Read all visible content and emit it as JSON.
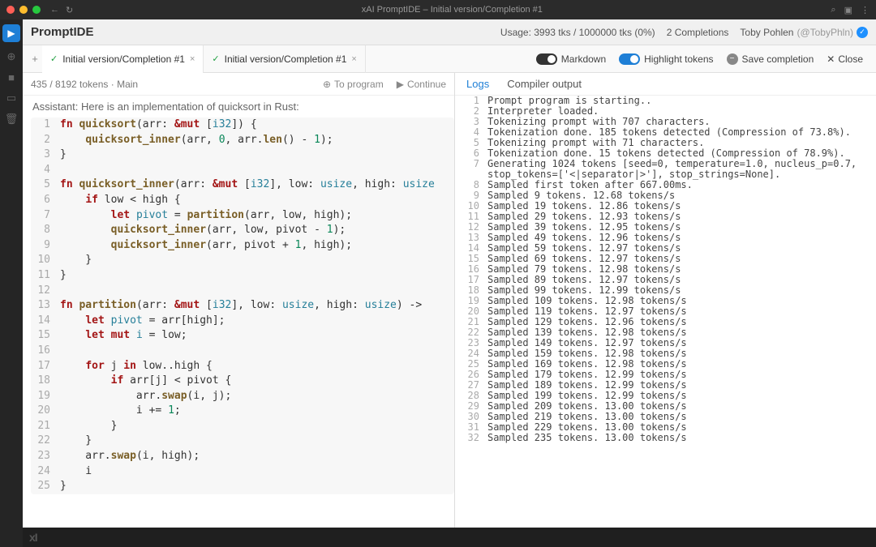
{
  "window": {
    "title": "xAI PromptIDE – Initial version/Completion #1"
  },
  "topbar": {
    "brand": "PromptIDE",
    "usage": "Usage: 3993 tks / 1000000 tks (0%)",
    "completions": "2 Completions",
    "user_name": "Toby Pohlen",
    "user_handle": "(@TobyPhln)"
  },
  "tabs": [
    {
      "label": "Initial version/Completion #1",
      "active": true
    },
    {
      "label": "Initial version/Completion #1",
      "active": false
    }
  ],
  "tabrow": {
    "markdown": "Markdown",
    "highlight": "Highlight tokens",
    "save": "Save completion",
    "close": "Close"
  },
  "infobar": {
    "tokens": "435 / 8192 tokens · Main",
    "toprogram": "To program",
    "continue": "Continue"
  },
  "assistant_line": "Assistant: Here is an implementation of quicksort in Rust:",
  "code": [
    {
      "n": 1,
      "t": [
        [
          "kw",
          "fn "
        ],
        [
          "fn",
          "quicksort"
        ],
        [
          "",
          "(arr: "
        ],
        [
          "kw",
          "&mut"
        ],
        [
          "",
          " ["
        ],
        [
          "ty",
          "i32"
        ],
        [
          "",
          "]) {"
        ]
      ]
    },
    {
      "n": 2,
      "t": [
        [
          "",
          "    "
        ],
        [
          "fn",
          "quicksort_inner"
        ],
        [
          "",
          "(arr, "
        ],
        [
          "nm",
          "0"
        ],
        [
          "",
          ", arr."
        ],
        [
          "fn",
          "len"
        ],
        [
          "",
          "() - "
        ],
        [
          "nm",
          "1"
        ],
        [
          "",
          ");"
        ]
      ]
    },
    {
      "n": 3,
      "t": [
        [
          "",
          "}"
        ]
      ]
    },
    {
      "n": 4,
      "t": [
        [
          "",
          ""
        ]
      ]
    },
    {
      "n": 5,
      "t": [
        [
          "kw",
          "fn "
        ],
        [
          "fn",
          "quicksort_inner"
        ],
        [
          "",
          "(arr: "
        ],
        [
          "kw",
          "&mut"
        ],
        [
          "",
          " ["
        ],
        [
          "ty",
          "i32"
        ],
        [
          "",
          "], low: "
        ],
        [
          "ty",
          "usize"
        ],
        [
          "",
          ", high: "
        ],
        [
          "ty",
          "usize"
        ]
      ]
    },
    {
      "n": 6,
      "t": [
        [
          "",
          "    "
        ],
        [
          "kw",
          "if"
        ],
        [
          "",
          " low < high {"
        ]
      ]
    },
    {
      "n": 7,
      "t": [
        [
          "",
          "        "
        ],
        [
          "kw",
          "let"
        ],
        [
          "",
          " "
        ],
        [
          "ty",
          "pivot"
        ],
        [
          "",
          " = "
        ],
        [
          "fn",
          "partition"
        ],
        [
          "",
          "(arr, low, high);"
        ]
      ]
    },
    {
      "n": 8,
      "t": [
        [
          "",
          "        "
        ],
        [
          "fn",
          "quicksort_inner"
        ],
        [
          "",
          "(arr, low, pivot - "
        ],
        [
          "nm",
          "1"
        ],
        [
          "",
          ");"
        ]
      ]
    },
    {
      "n": 9,
      "t": [
        [
          "",
          "        "
        ],
        [
          "fn",
          "quicksort_inner"
        ],
        [
          "",
          "(arr, pivot + "
        ],
        [
          "nm",
          "1"
        ],
        [
          "",
          ", high);"
        ]
      ]
    },
    {
      "n": 10,
      "t": [
        [
          "",
          "    }"
        ]
      ]
    },
    {
      "n": 11,
      "t": [
        [
          "",
          "}"
        ]
      ]
    },
    {
      "n": 12,
      "t": [
        [
          "",
          ""
        ]
      ]
    },
    {
      "n": 13,
      "t": [
        [
          "kw",
          "fn "
        ],
        [
          "fn",
          "partition"
        ],
        [
          "",
          "(arr: "
        ],
        [
          "kw",
          "&mut"
        ],
        [
          "",
          " ["
        ],
        [
          "ty",
          "i32"
        ],
        [
          "",
          "], low: "
        ],
        [
          "ty",
          "usize"
        ],
        [
          "",
          ", high: "
        ],
        [
          "ty",
          "usize"
        ],
        [
          "",
          ") -> "
        ]
      ]
    },
    {
      "n": 14,
      "t": [
        [
          "",
          "    "
        ],
        [
          "kw",
          "let"
        ],
        [
          "",
          " "
        ],
        [
          "ty",
          "pivot"
        ],
        [
          "",
          " = arr[high];"
        ]
      ]
    },
    {
      "n": 15,
      "t": [
        [
          "",
          "    "
        ],
        [
          "kw",
          "let mut"
        ],
        [
          "",
          " "
        ],
        [
          "ty",
          "i"
        ],
        [
          "",
          " = low;"
        ]
      ]
    },
    {
      "n": 16,
      "t": [
        [
          "",
          ""
        ]
      ]
    },
    {
      "n": 17,
      "t": [
        [
          "",
          "    "
        ],
        [
          "kw",
          "for"
        ],
        [
          "",
          " j "
        ],
        [
          "kw",
          "in"
        ],
        [
          "",
          " low..high {"
        ]
      ]
    },
    {
      "n": 18,
      "t": [
        [
          "",
          "        "
        ],
        [
          "kw",
          "if"
        ],
        [
          "",
          " arr[j] < pivot {"
        ]
      ]
    },
    {
      "n": 19,
      "t": [
        [
          "",
          "            arr."
        ],
        [
          "fn",
          "swap"
        ],
        [
          "",
          "(i, j);"
        ]
      ]
    },
    {
      "n": 20,
      "t": [
        [
          "",
          "            i += "
        ],
        [
          "nm",
          "1"
        ],
        [
          "",
          ";"
        ]
      ]
    },
    {
      "n": 21,
      "t": [
        [
          "",
          "        }"
        ]
      ]
    },
    {
      "n": 22,
      "t": [
        [
          "",
          "    }"
        ]
      ]
    },
    {
      "n": 23,
      "t": [
        [
          "",
          "    arr."
        ],
        [
          "fn",
          "swap"
        ],
        [
          "",
          "(i, high);"
        ]
      ]
    },
    {
      "n": 24,
      "t": [
        [
          "",
          "    i"
        ]
      ]
    },
    {
      "n": 25,
      "t": [
        [
          "",
          "}"
        ]
      ]
    }
  ],
  "right_tabs": {
    "logs": "Logs",
    "compiler": "Compiler output"
  },
  "logs": [
    "Prompt program is starting..",
    "Interpreter loaded.",
    "Tokenizing prompt with 707 characters.",
    "Tokenization done. 185 tokens detected (Compression of 73.8%).",
    "Tokenizing prompt with 71 characters.",
    "Tokenization done. 15 tokens detected (Compression of 78.9%).",
    "Generating 1024 tokens [seed=0, temperature=1.0, nucleus_p=0.7, stop_tokens=['<|separator|>'], stop_strings=None].",
    "Sampled first token after 667.00ms.",
    "Sampled 9 tokens. 12.68 tokens/s",
    "Sampled 19 tokens. 12.86 tokens/s",
    "Sampled 29 tokens. 12.93 tokens/s",
    "Sampled 39 tokens. 12.95 tokens/s",
    "Sampled 49 tokens. 12.96 tokens/s",
    "Sampled 59 tokens. 12.97 tokens/s",
    "Sampled 69 tokens. 12.97 tokens/s",
    "Sampled 79 tokens. 12.98 tokens/s",
    "Sampled 89 tokens. 12.97 tokens/s",
    "Sampled 99 tokens. 12.99 tokens/s",
    "Sampled 109 tokens. 12.98 tokens/s",
    "Sampled 119 tokens. 12.97 tokens/s",
    "Sampled 129 tokens. 12.96 tokens/s",
    "Sampled 139 tokens. 12.98 tokens/s",
    "Sampled 149 tokens. 12.97 tokens/s",
    "Sampled 159 tokens. 12.98 tokens/s",
    "Sampled 169 tokens. 12.98 tokens/s",
    "Sampled 179 tokens. 12.99 tokens/s",
    "Sampled 189 tokens. 12.99 tokens/s",
    "Sampled 199 tokens. 12.99 tokens/s",
    "Sampled 209 tokens. 13.00 tokens/s",
    "Sampled 219 tokens. 13.00 tokens/s",
    "Sampled 229 tokens. 13.00 tokens/s",
    "Sampled 235 tokens. 13.00 tokens/s"
  ],
  "bottombar": {
    "logo": "xI"
  }
}
